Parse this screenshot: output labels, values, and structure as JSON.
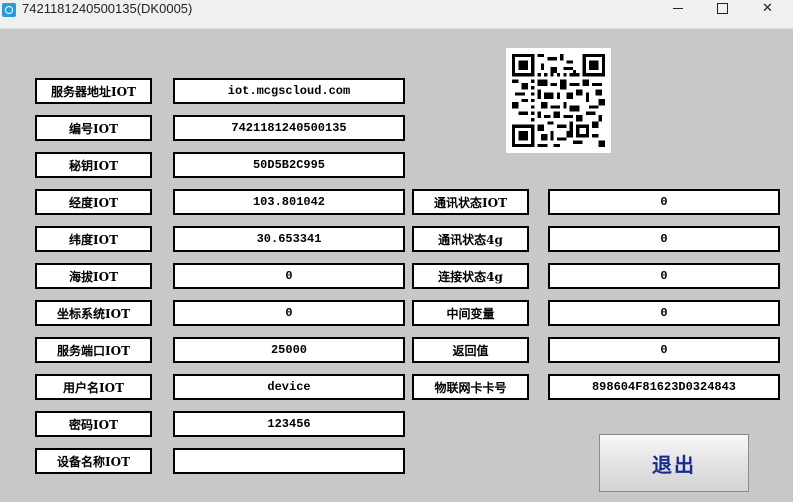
{
  "window": {
    "title": "7421181240500135(DK0005)"
  },
  "form": {
    "server_label": "服务器地址IOT",
    "server_value": "iot.mcgscloud.com",
    "id_label": "编号IOT",
    "id_value": "7421181240500135",
    "key_label": "秘钥IOT",
    "key_value": "50D5B2C995",
    "lon_label": "经度IOT",
    "lon_value": "103.801042",
    "lat_label": "纬度IOT",
    "lat_value": "30.653341",
    "alt_label": "海拔IOT",
    "alt_value": "0",
    "coord_label": "坐标系统IOT",
    "coord_value": "0",
    "port_label": "服务端口IOT",
    "port_value": "25000",
    "user_label": "用户名IOT",
    "user_value": "device",
    "pwd_label": "密码IOT",
    "pwd_value": "123456",
    "device_label": "设备名称IOT",
    "device_value": ""
  },
  "status": {
    "comm_iot_label": "通讯状态IOT",
    "comm_iot_value": "0",
    "comm_4g_label": "通讯状态4g",
    "comm_4g_value": "0",
    "conn_4g_label": "连接状态4g",
    "conn_4g_value": "0",
    "mid_var_label": "中间变量",
    "mid_var_value": "0",
    "return_label": "返回值",
    "return_value": "0",
    "iccid_label": "物联网卡卡号",
    "iccid_value": "898604F81623D0324843"
  },
  "exit_label": "退出",
  "icons": {
    "app": "app-icon",
    "qr": "qr-code-icon"
  }
}
